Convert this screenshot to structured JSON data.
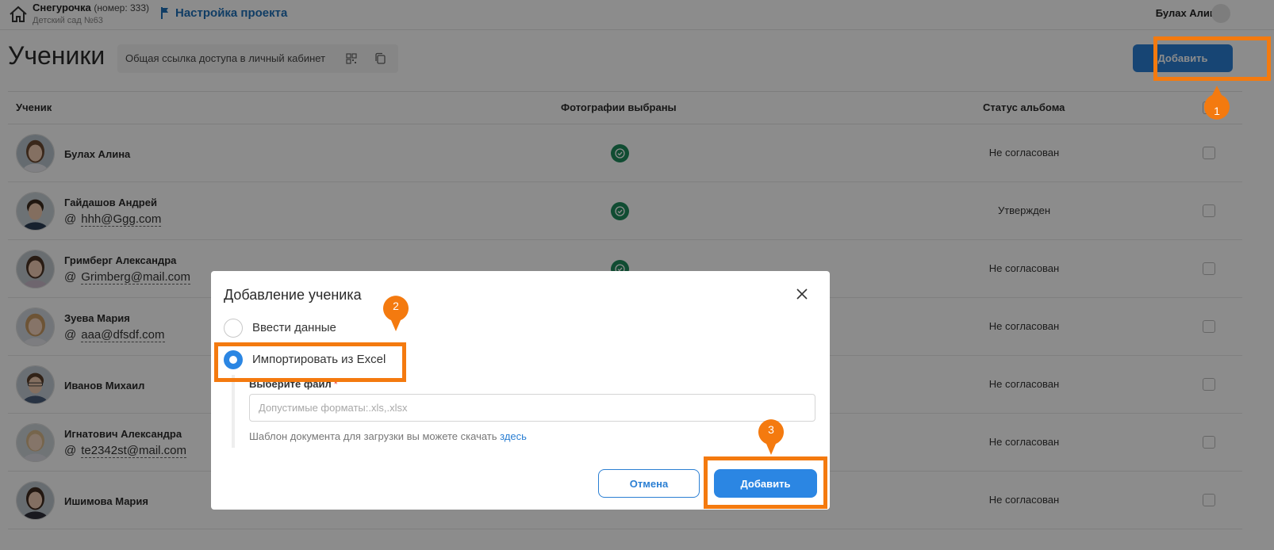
{
  "header": {
    "project_name": "Снегурочка",
    "project_number": "(номер: 333)",
    "project_sub": "Детский сад №63",
    "settings_link": "Настройка проекта",
    "user_name": "Булах Алина"
  },
  "page": {
    "title": "Ученики",
    "share_text": "Общая ссылка доступа в личный кабинет",
    "add_button": "Добавить"
  },
  "table": {
    "columns": {
      "student": "Ученик",
      "photos": "Фотографии выбраны",
      "status": "Статус альбома"
    },
    "rows": [
      {
        "name": "Булах Алина",
        "email": "",
        "photos_selected": true,
        "status": "Не согласован"
      },
      {
        "name": "Гайдашов Андрей",
        "email": "hhh@Ggg.com",
        "photos_selected": true,
        "status": "Утвержден"
      },
      {
        "name": "Гримберг Александра",
        "email": "Grimberg@mail.com",
        "photos_selected": true,
        "status": "Не согласован"
      },
      {
        "name": "Зуева Мария",
        "email": "aaa@dfsdf.com",
        "photos_selected": true,
        "status": "Не согласован"
      },
      {
        "name": "Иванов Михаил",
        "email": "",
        "photos_selected": true,
        "status": "Не согласован"
      },
      {
        "name": "Игнатович Александра",
        "email": "te2342st@mail.com",
        "photos_selected": true,
        "status": "Не согласован"
      },
      {
        "name": "Ишимова Мария",
        "email": "",
        "photos_selected": true,
        "status": "Не согласован"
      }
    ],
    "email_prefix": "@"
  },
  "modal": {
    "title": "Добавление ученика",
    "option_manual": "Ввести данные",
    "option_excel": "Импортировать из Excel",
    "selected_option": "Импортировать из Excel",
    "file_label": "Выберите файл",
    "required_mark": "*",
    "file_placeholder": "Допустимые форматы:.xls,.xlsx",
    "template_text": "Шаблон документа для загрузки вы можете скачать",
    "template_link": "здесь",
    "cancel_button": "Отмена",
    "add_button": "Добавить"
  },
  "annotations": {
    "color": "#f47a0f",
    "step1": "1",
    "step2": "2",
    "step3": "3"
  },
  "colors": {
    "primary": "#2b7fd3",
    "success": "#1e8a5c",
    "annotation": "#f47a0f"
  }
}
